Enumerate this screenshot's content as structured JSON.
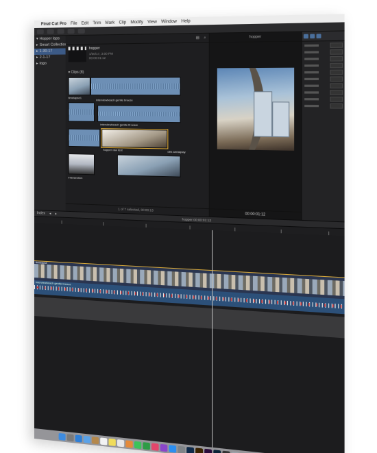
{
  "menubar": {
    "app": "Final Cut Pro",
    "items": [
      "File",
      "Edit",
      "Trim",
      "Mark",
      "Clip",
      "Modify",
      "View",
      "Window",
      "Help"
    ]
  },
  "sidebar": {
    "items": [
      {
        "label": "Hopper laps",
        "selected": false
      },
      {
        "label": "Smart Collections",
        "selected": false
      },
      {
        "label": "1-30-17",
        "selected": true
      },
      {
        "label": "2-1-17",
        "selected": false
      },
      {
        "label": "logo",
        "selected": false
      }
    ]
  },
  "browser": {
    "event_title": "hopper",
    "event_meta_1": "1/30/17, 3:00 PM",
    "event_meta_2": "00:00:01:12",
    "clips_label": "Clips",
    "clips_count": "(8)",
    "footer": "1 of 7 selected, 00:00:13",
    "clip_labels": [
      "timelapse1",
      "interviewbeach gentle breeze",
      "interviewbeach gentle lit wave",
      "hopper raw test",
      "dirk aerialplay",
      "intersection"
    ]
  },
  "viewer": {
    "title": "hopper",
    "timecode": "00:00:01:12"
  },
  "timeline": {
    "index_label": "Index",
    "title": "hopper",
    "duration": "00:00:01:12",
    "video_label": "timelapse",
    "audio_label": "interviewbeach gentle breeze"
  },
  "colors": {
    "accent": "#3c5a86",
    "selection": "#e8b23a",
    "audio": "#2c5079"
  },
  "dock": {
    "icons": [
      "finder-icon",
      "launchpad-icon",
      "safari-icon",
      "mail-icon",
      "contacts-icon",
      "calendar-icon",
      "notes-icon",
      "reminders-icon",
      "photos-icon",
      "messages-icon",
      "facetime-icon",
      "music-icon",
      "podcasts-icon",
      "appstore-icon",
      "prefs-icon",
      "photoshop-icon",
      "illustrator-icon",
      "premiere-icon",
      "lightroom-icon",
      "finalcut-icon",
      "trash-icon"
    ]
  }
}
